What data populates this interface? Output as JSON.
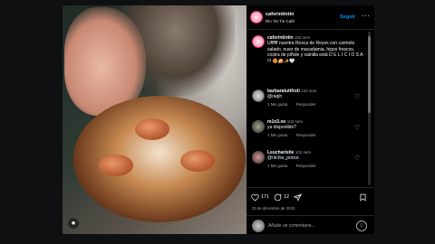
{
  "header": {
    "username": "caferintintin",
    "subtitle": "Rin Tin Tin Café",
    "follow_label": "Seguir",
    "more_label": "···"
  },
  "caption": {
    "username": "caferintintin",
    "time": "102 sem",
    "text": "Uffffff nuestra Rosca de Reyes con carmelo salado, nuez de macadamia, higos frescos, costra de piñole y vainilla está D E L I C I O S A !!! 😍🍰✨🤍"
  },
  "comments": [
    {
      "username": "barbaratutifruti",
      "time": "102 sem",
      "text": "@raqih",
      "likes_label": "1 Me gusta",
      "reply_label": "Responder"
    },
    {
      "username": "m1n3.ov",
      "time": "102 sem",
      "text": "ya disponible?",
      "likes_label": "1 Me gusta",
      "reply_label": "Responder"
    },
    {
      "username": "Leucharistie",
      "time": "102 sem",
      "text": "@ritchie_ponce",
      "likes_label": "1 Me gusta",
      "reply_label": "Responder"
    }
  ],
  "actions": {
    "likes": "171",
    "comments": "12",
    "date": "23 de diciembre de 2023"
  },
  "add_comment": {
    "placeholder": "Añade un comentario..."
  },
  "colors": {
    "accent": "#0095f6",
    "background": "#000000",
    "muted": "#a8a8a8"
  },
  "icons": [
    "more-icon",
    "heart-icon",
    "comment-icon",
    "share-icon",
    "bookmark-icon",
    "emoji-icon",
    "user-tag-icon"
  ]
}
